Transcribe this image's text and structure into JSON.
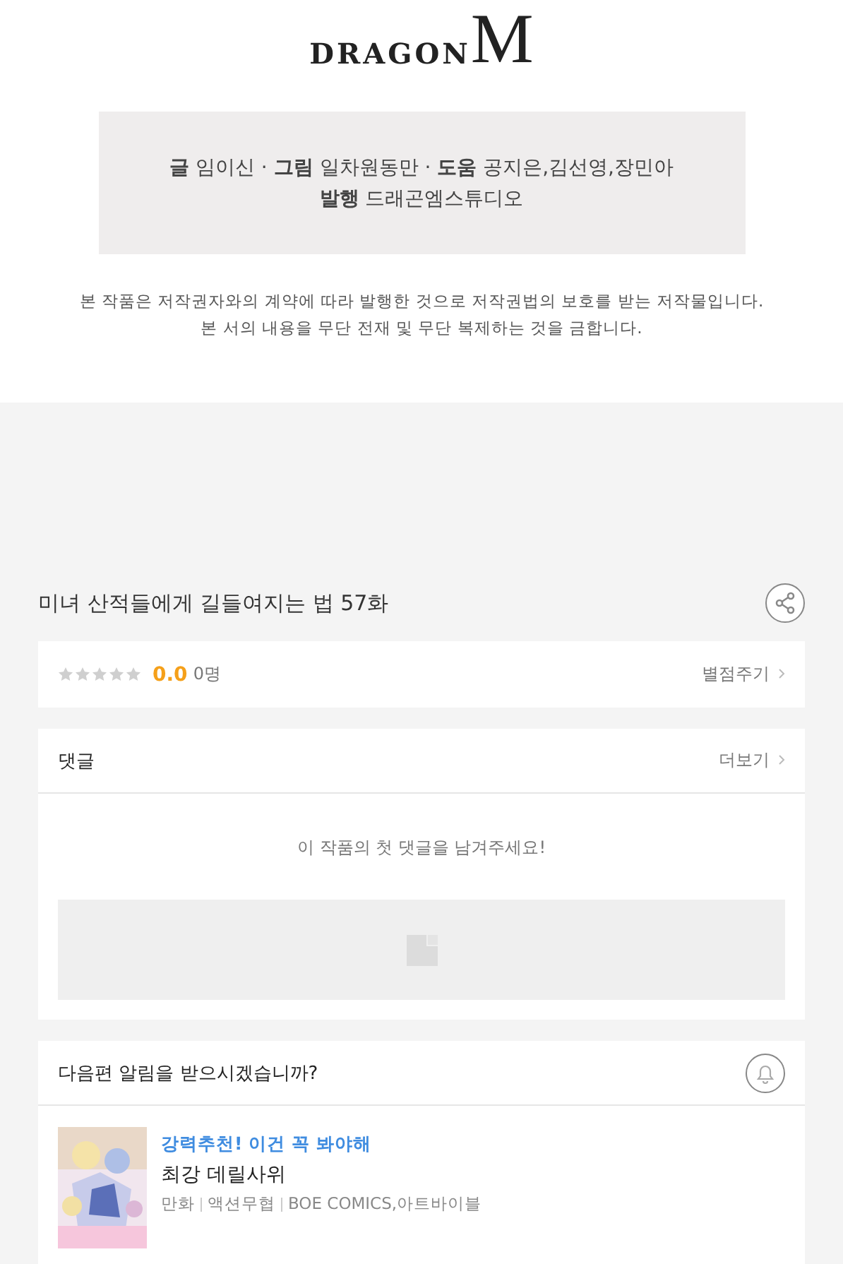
{
  "logo": {
    "word": "DRAGON",
    "letter": "M"
  },
  "credits": [
    "**글** 임이신 · **그림** 일차원동만 · **도움** 공지은,김선영,장민아",
    "**발행** 드래곤엠스튜디오"
  ],
  "notice": [
    "본 작품은 저작권자와의 계약에 따라 발행한 것으로 저작권법의 보호를 받는 저작물입니다.",
    "본 서의 내용을 무단 전재 및 무단 복제하는 것을 금합니다."
  ],
  "episode_title": "미녀 산적들에게 길들여지는 법 57화",
  "rating": {
    "stars": 0,
    "score": "0.0",
    "count": "0명",
    "action": "별점주기"
  },
  "comments": {
    "title": "댓글",
    "more": "더보기",
    "empty_message": "이 작품의 첫 댓글을 남겨주세요!"
  },
  "notify": {
    "question": "다음편 알림을 받으시겠습니까?"
  },
  "recommendation": {
    "tagline": "강력추천! 이건 꼭 봐야해",
    "title": "최강 데릴사위",
    "meta": [
      "만화",
      "액션무협",
      "BOE COMICS,아트바이블"
    ]
  }
}
